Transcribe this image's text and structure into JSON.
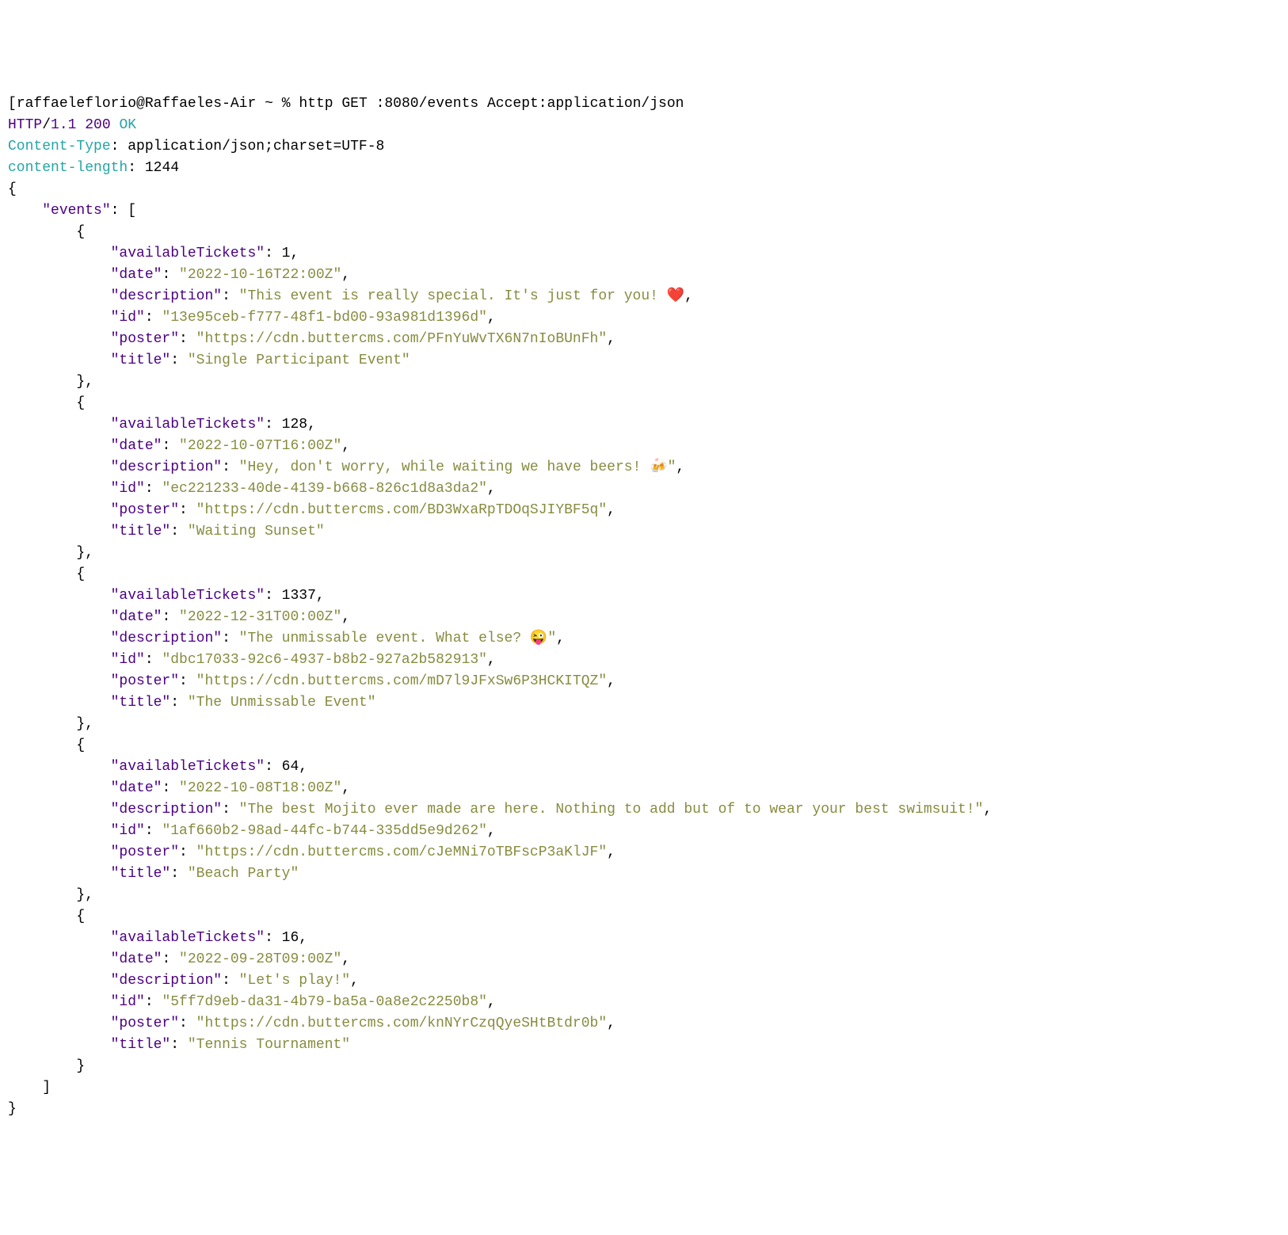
{
  "prompt": {
    "user": "raffaeleflorio",
    "host": "Raffaeles-Air",
    "cwd": "~",
    "symbol": "%",
    "command": "http GET :8080/events Accept:application/json"
  },
  "response": {
    "protocol": "HTTP",
    "slash": "/",
    "version": "1.1",
    "status_code": "200",
    "status_text": "OK",
    "content_type_key": "Content-Type",
    "content_type_value": "application/json;charset=UTF-8",
    "content_length_key": "content-length",
    "content_length_value": "1244"
  },
  "punct": {
    "open_brace": "{",
    "close_brace": "}",
    "open_bracket": "[",
    "close_bracket": "]",
    "colon": ":",
    "comma": ",",
    "quote": "\""
  },
  "keys": {
    "events": "\"events\"",
    "availableTickets": "\"availableTickets\"",
    "date": "\"date\"",
    "description": "\"description\"",
    "id": "\"id\"",
    "poster": "\"poster\"",
    "title": "\"title\""
  },
  "events": [
    {
      "availableTickets": "1",
      "date": "\"2022-10-16T22:00Z\"",
      "description": "\"This event is really special. It's just for you! ❤️",
      "id": "\"13e95ceb-f777-48f1-bd00-93a981d1396d\"",
      "poster": "\"https://cdn.buttercms.com/PFnYuWvTX6N7nIoBUnFh\"",
      "title": "\"Single Participant Event\""
    },
    {
      "availableTickets": "128",
      "date": "\"2022-10-07T16:00Z\"",
      "description": "\"Hey, don't worry, while waiting we have beers! 🍻\"",
      "id": "\"ec221233-40de-4139-b668-826c1d8a3da2\"",
      "poster": "\"https://cdn.buttercms.com/BD3WxaRpTDOqSJIYBF5q\"",
      "title": "\"Waiting Sunset\""
    },
    {
      "availableTickets": "1337",
      "date": "\"2022-12-31T00:00Z\"",
      "description": "\"The unmissable event. What else? 😜\"",
      "id": "\"dbc17033-92c6-4937-b8b2-927a2b582913\"",
      "poster": "\"https://cdn.buttercms.com/mD7l9JFxSw6P3HCKITQZ\"",
      "title": "\"The Unmissable Event\""
    },
    {
      "availableTickets": "64",
      "date": "\"2022-10-08T18:00Z\"",
      "description": "\"The best Mojito ever made are here. Nothing to add but of to wear your best swimsuit!\"",
      "id": "\"1af660b2-98ad-44fc-b744-335dd5e9d262\"",
      "poster": "\"https://cdn.buttercms.com/cJeMNi7oTBFscP3aKlJF\"",
      "title": "\"Beach Party\""
    },
    {
      "availableTickets": "16",
      "date": "\"2022-09-28T09:00Z\"",
      "description": "\"Let's play!\"",
      "id": "\"5ff7d9eb-da31-4b79-ba5a-0a8e2c2250b8\"",
      "poster": "\"https://cdn.buttercms.com/knNYrCzqQyeSHtBtdr0b\"",
      "title": "\"Tennis Tournament\""
    }
  ]
}
